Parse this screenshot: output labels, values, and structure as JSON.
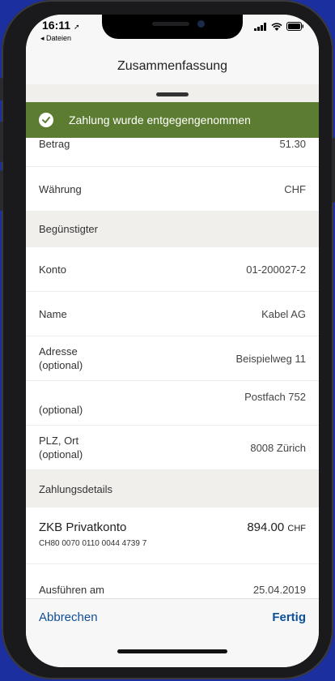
{
  "status_bar": {
    "time": "16:11",
    "back_app": "◂ Dateien"
  },
  "nav": {
    "title": "Zusammenfassung"
  },
  "toast": {
    "message": "Zahlung wurde entgegengenommen"
  },
  "partial_row": {
    "label": "Betrag",
    "value": "51.30"
  },
  "currency_row": {
    "label": "Währung",
    "value": "CHF"
  },
  "beneficiary": {
    "section_title": "Begünstigter",
    "rows": [
      {
        "label": "Konto",
        "sublabel": "",
        "value": "01-200027-2"
      },
      {
        "label": "Name",
        "sublabel": "",
        "value": "Kabel AG"
      },
      {
        "label": "Adresse",
        "sublabel": "(optional)",
        "value": "Beispielweg 11"
      },
      {
        "label": "",
        "sublabel": "(optional)",
        "value": "Postfach 752"
      },
      {
        "label": "PLZ, Ort",
        "sublabel": "(optional)",
        "value": "8008 Zürich"
      }
    ]
  },
  "payment_details": {
    "section_title": "Zahlungsdetails",
    "account_name": "ZKB Privatkonto",
    "iban": "CH80 0070 0110 0044 4739 7",
    "amount": "894.00",
    "currency": "CHF",
    "execute_label": "Ausführen am",
    "execute_date": "25.04.2019"
  },
  "footer": {
    "cancel_label": "Abbrechen",
    "done_label": "Fertig"
  },
  "colors": {
    "toast_bg": "#5c7c31",
    "action_blue": "#0d4e9a",
    "section_bg": "#f1efec"
  }
}
